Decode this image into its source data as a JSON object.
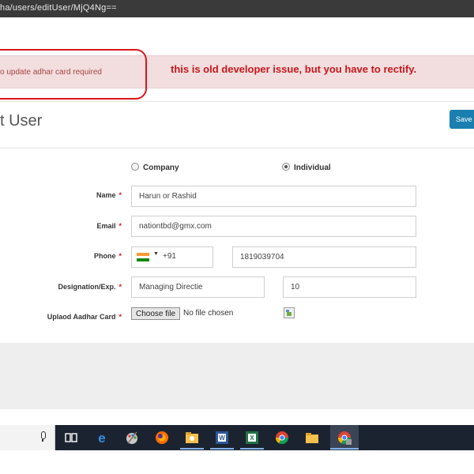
{
  "browser": {
    "url": "ha/users/editUser/MjQ4Ng=="
  },
  "alert": {
    "message": "o update adhar card required",
    "annotation": "this is old developer issue, but you have to rectify."
  },
  "page": {
    "title": "t User",
    "save_label": "Save"
  },
  "form": {
    "user_type": {
      "options": [
        "Company",
        "Individual"
      ],
      "selected": "Individual"
    },
    "name": {
      "label": "Name",
      "value": "Harun or Rashid"
    },
    "email": {
      "label": "Email",
      "value": "nationtbd@gmx.com"
    },
    "phone": {
      "label": "Phone",
      "dial_code": "+91",
      "value": "1819039704",
      "flag": "india-flag-icon"
    },
    "designation": {
      "label": "Designation/Exp.",
      "value": "Managing Directie",
      "experience": "10"
    },
    "aadhar": {
      "label": "Uplaod Aadhar Card",
      "button": "Choose file",
      "status": "No file chosen"
    },
    "required_mark": "*"
  },
  "taskbar": {
    "icons": [
      "microphone-icon",
      "task-view-icon",
      "edge-icon",
      "paint-icon",
      "firefox-icon",
      "explorer-folder-icon",
      "word-icon",
      "excel-icon",
      "chrome-icon",
      "file-explorer-icon",
      "chrome-profile-icon"
    ]
  },
  "colors": {
    "alert_bg": "#f2dede",
    "alert_text": "#a94442",
    "annotation_red": "#c8161c",
    "save_button": "#1a7fae",
    "taskbar": "#1c2330"
  }
}
